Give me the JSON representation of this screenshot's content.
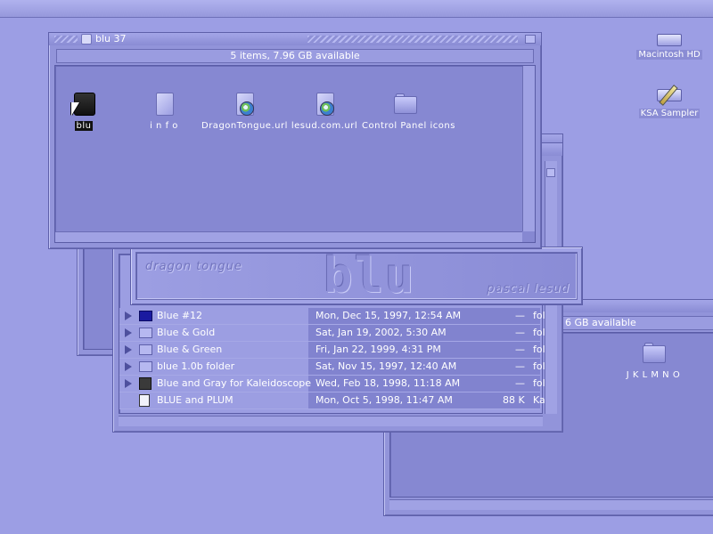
{
  "front_window": {
    "title": "blu 37",
    "status": "5 items, 7.96 GB available",
    "icons": [
      {
        "label": "blu",
        "icon": "app-box-icon",
        "selected": true
      },
      {
        "label": "i n f o",
        "icon": "document-icon",
        "selected": false
      },
      {
        "label": "DragonTongue.url",
        "icon": "globe-doc-icon",
        "selected": false
      },
      {
        "label": "lesud.com.url",
        "icon": "globe-doc-icon",
        "selected": false
      },
      {
        "label": "Control Panel icons",
        "icon": "folder-icon",
        "selected": false
      }
    ]
  },
  "list_window": {
    "rows": [
      {
        "name": "Blue #12",
        "date": "Mon, Dec 15, 1997, 12:54 AM",
        "size": "—",
        "kind": "fol",
        "icon": "folder-dark"
      },
      {
        "name": "Blue & Gold",
        "date": "Sat, Jan 19, 2002, 5:30 AM",
        "size": "—",
        "kind": "fol",
        "icon": "folder"
      },
      {
        "name": "Blue & Green",
        "date": "Fri, Jan 22, 1999, 4:31 PM",
        "size": "—",
        "kind": "fol",
        "icon": "folder"
      },
      {
        "name": "blue 1.0b folder",
        "date": "Sat, Nov 15, 1997, 12:40 AM",
        "size": "—",
        "kind": "fol",
        "icon": "folder"
      },
      {
        "name": "Blue and Gray for Kaleidoscope",
        "date": "Wed, Feb 18, 1998, 11:18 AM",
        "size": "—",
        "kind": "fol",
        "icon": "app"
      },
      {
        "name": "BLUE and PLUM",
        "date": "Mon, Oct 5, 1998, 11:47 AM",
        "size": "88 K",
        "kind": "Ka",
        "icon": "doc"
      }
    ]
  },
  "right_window": {
    "status": "6 GB available",
    "folder_label": "J K L M N O"
  },
  "splash": {
    "left_text": "dragon tongue",
    "big_text": "blu",
    "right_text": "pascal lesud"
  },
  "desktop": {
    "icons": [
      {
        "label": "Macintosh HD",
        "icon": "hard-drive-icon"
      },
      {
        "label": "KSA Sampler",
        "icon": "pencil-disk-icon"
      }
    ]
  },
  "colors": {
    "desktop": "#9c9ee4",
    "window": "#9294da",
    "content": "#8688d2"
  }
}
